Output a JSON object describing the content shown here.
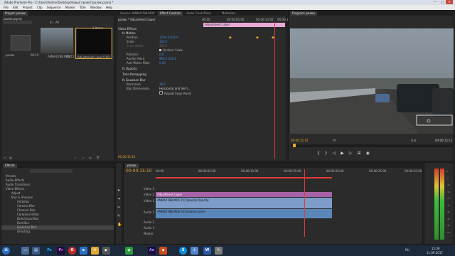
{
  "window": {
    "title": "Adobe Premiere Pro - C:\\Users\\Admin\\Desktop\\Новый проект\\ролик.prproj *"
  },
  "menu": [
    "File",
    "Edit",
    "Project",
    "Clip",
    "Sequence",
    "Marker",
    "Title",
    "Window",
    "Help"
  ],
  "project": {
    "tab": "Project: ролик",
    "file": "ролик.prproj",
    "count": "3 Items",
    "in_label": "In:",
    "in_value": "All",
    "items": [
      {
        "name": "ролик",
        "duration": "00:15"
      },
      {
        "name": "AMBA0788.MOV",
        "duration": "00:15"
      },
      {
        "name": "Adjustment Layer",
        "duration": "5:00"
      }
    ]
  },
  "effect_controls": {
    "tabs": [
      "Source: AMBA0788.MOV",
      "Effect Controls",
      "Audio Track Mixer",
      "Metadata"
    ],
    "header": "ролик * Adjustment Layer",
    "times": [
      "00:00",
      "00:00:05:00",
      "00:00:10:00",
      "00:00:15:00"
    ],
    "clip_label": "Adjustment Layer",
    "rows": [
      {
        "label": "Video Effects",
        "value": ""
      },
      {
        "label": "fx Motion",
        "value": ""
      },
      {
        "label": "Position",
        "value": "1296.0   844.6"
      },
      {
        "label": "Scale",
        "value": "100.0"
      },
      {
        "label": "Scale Width",
        "value": "100.0"
      },
      {
        "label": "Uniform Scale",
        "value": ""
      },
      {
        "label": "Rotation",
        "value": "0.0"
      },
      {
        "label": "Anchor Point",
        "value": "960.0   540.0"
      },
      {
        "label": "Anti-flicker Filter",
        "value": "0.00"
      },
      {
        "label": "fx Opacity",
        "value": ""
      },
      {
        "label": "Time Remapping",
        "value": ""
      },
      {
        "label": "fx Gaussian Blur",
        "value": ""
      },
      {
        "label": "Blurriness",
        "value": "38.0"
      },
      {
        "label": "Blur Dimensions",
        "value": "Horizontal and Verti..."
      },
      {
        "label": "Repeat Edge Pixels",
        "value": ""
      }
    ],
    "bottom_time": "00:00:15:10"
  },
  "program": {
    "tab": "Program: ролик",
    "timecode_left": "00:00:15:10",
    "fit": "Fit",
    "quality": "Full",
    "timecode_right": "00:00:15:13"
  },
  "effects": {
    "tab": "Effects",
    "search": "",
    "items": [
      "Presets",
      "Audio Effects",
      "Audio Transitions",
      "Video Effects",
      "Adjust",
      "Blur & Sharpen",
      "Antialias",
      "Camera Blur",
      "Channel Blur",
      "Compound Blur",
      "Directional Blur",
      "Fast Blur",
      "Gaussian Blur",
      "Ghosting"
    ]
  },
  "timeline": {
    "tab": "ролик",
    "timecode": "00:00:15:10",
    "ruler": [
      "00:00",
      "00:00:05:00",
      "00:00:10:00",
      "00:00:15:00",
      "00:00:20:00",
      "00:00:25:00",
      "00:00:30:00"
    ],
    "tracks": [
      "Video 3",
      "Video 2",
      "Video 1",
      "Audio 1",
      "Audio 2",
      "Audio 3",
      "Master"
    ],
    "clip_adjustment": "Adjustment Layer",
    "clip_video": "AMBA0788.MOV [V]  Opacity:Opacity",
    "clip_audio": "AMBA0788.MOV [A]  Volume:Level"
  },
  "meter": {
    "labels": [
      "0",
      "-6",
      "-12",
      "-18",
      "-24",
      "-30",
      "-36",
      "-42",
      "-48",
      "-54",
      "dB"
    ]
  },
  "taskbar": {
    "apps": [
      "Ps",
      "Pr",
      "O",
      "Ae",
      "S",
      "W"
    ],
    "lang": "RU",
    "time": "15:36",
    "date": "11.09.2017"
  },
  "colors": {
    "adjustment": "#a862a6",
    "video": "#7d9cc9",
    "audio": "#5b86b9",
    "playhead": "#e13b3b",
    "accent": "#e0a631"
  }
}
